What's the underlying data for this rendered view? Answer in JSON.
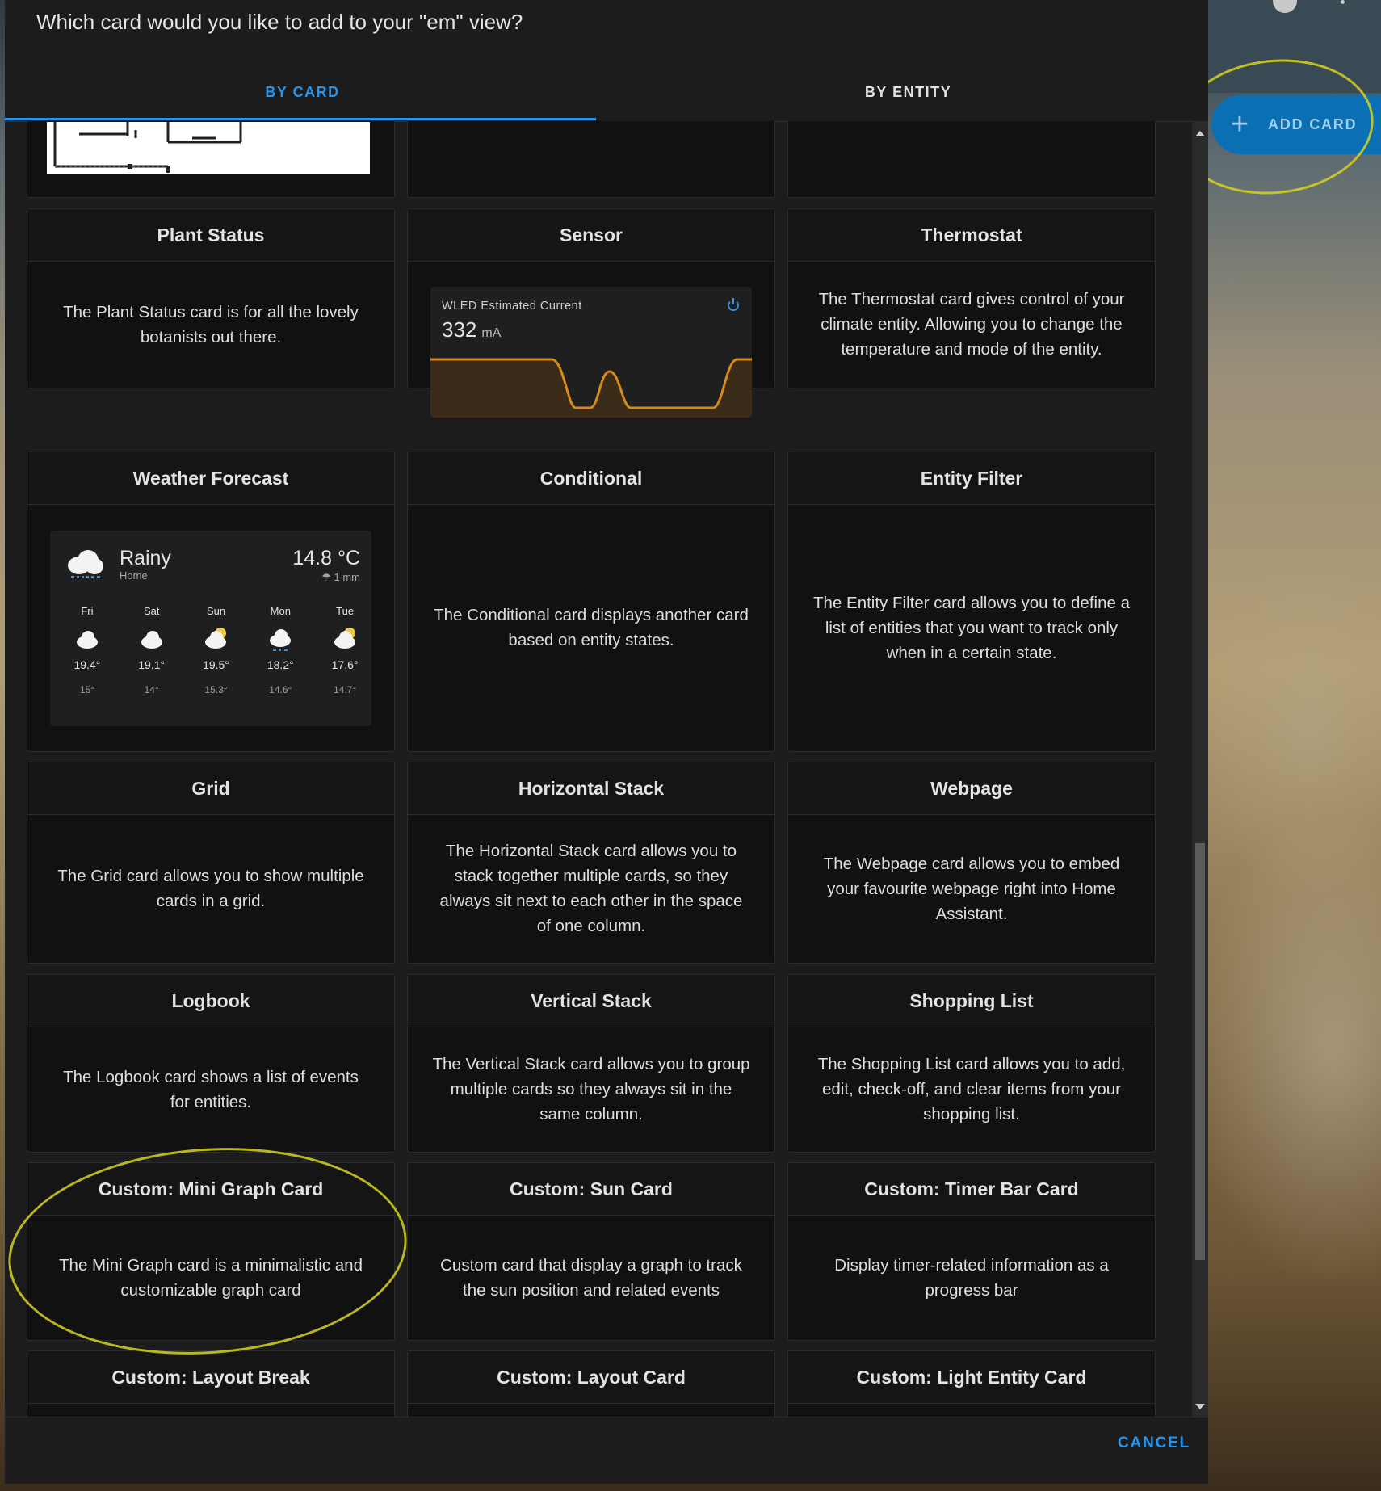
{
  "dialog": {
    "title": "Which card would you like to add to your \"em\" view?",
    "tabs": [
      {
        "label": "BY CARD",
        "active": true
      },
      {
        "label": "BY ENTITY",
        "active": false
      }
    ],
    "cancel_label": "CANCEL"
  },
  "header_action": {
    "add_card_label": "ADD CARD",
    "plus_glyph": "+"
  },
  "cards": [
    {
      "title": "Plant Status",
      "description": "The Plant Status card is for all the lovely botanists out there."
    },
    {
      "title": "Sensor",
      "preview": {
        "name": "WLED Estimated Current",
        "value": "332",
        "unit": "mA"
      }
    },
    {
      "title": "Thermostat",
      "description": "The Thermostat card gives control of your climate entity. Allowing you to change the temperature and mode of the entity."
    },
    {
      "title": "Weather Forecast",
      "preview": {
        "condition": "Rainy",
        "location": "Home",
        "temperature": "14.8 °C",
        "precipitation": "1 mm",
        "forecast": [
          {
            "day": "Fri",
            "high": "19.4°",
            "low": "15°",
            "icon": "cloudy-icon"
          },
          {
            "day": "Sat",
            "high": "19.1°",
            "low": "14°",
            "icon": "cloudy-icon"
          },
          {
            "day": "Sun",
            "high": "19.5°",
            "low": "15.3°",
            "icon": "partly-cloudy-icon"
          },
          {
            "day": "Mon",
            "high": "18.2°",
            "low": "14.6°",
            "icon": "rainy-icon"
          },
          {
            "day": "Tue",
            "high": "17.6°",
            "low": "14.7°",
            "icon": "partly-cloudy-icon"
          }
        ]
      }
    },
    {
      "title": "Conditional",
      "description": "The Conditional card displays another card based on entity states."
    },
    {
      "title": "Entity Filter",
      "description": "The Entity Filter card allows you to define a list of entities that you want to track only when in a certain state."
    },
    {
      "title": "Grid",
      "description": "The Grid card allows you to show multiple cards in a grid."
    },
    {
      "title": "Horizontal Stack",
      "description": "The Horizontal Stack card allows you to stack together multiple cards, so they always sit next to each other in the space of one column."
    },
    {
      "title": "Webpage",
      "description": "The Webpage card allows you to embed your favourite webpage right into Home Assistant."
    },
    {
      "title": "Logbook",
      "description": "The Logbook card shows a list of events for entities."
    },
    {
      "title": "Vertical Stack",
      "description": "The Vertical Stack card allows you to group multiple cards so they always sit in the same column."
    },
    {
      "title": "Shopping List",
      "description": "The Shopping List card allows you to add, edit, check-off, and clear items from your shopping list."
    },
    {
      "title": "Custom: Mini Graph Card",
      "description": "The Mini Graph card is a minimalistic and customizable graph card"
    },
    {
      "title": "Custom: Sun Card",
      "description": "Custom card that display a graph to track the sun position and related events"
    },
    {
      "title": "Custom: Timer Bar Card",
      "description": "Display timer-related information as a progress bar"
    },
    {
      "title": "Custom: Layout Break"
    },
    {
      "title": "Custom: Layout Card"
    },
    {
      "title": "Custom: Light Entity Card"
    }
  ],
  "colors": {
    "accent": "#2196f3",
    "sensor_line": "#d8891c",
    "highlight_annotation": "#d7d21e"
  }
}
